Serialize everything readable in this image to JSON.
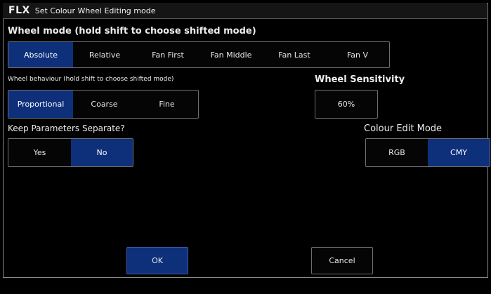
{
  "titlebar": {
    "logo": "FLX",
    "title": "Set Colour Wheel Editing mode"
  },
  "wheel_mode": {
    "heading": "Wheel mode (hold shift to choose shifted mode)",
    "options": [
      "Absolute",
      "Relative",
      "Fan First",
      "Fan Middle",
      "Fan Last",
      "Fan V"
    ],
    "selected": "Absolute"
  },
  "wheel_behaviour": {
    "heading": "Wheel behaviour (hold shift to choose shifted mode)",
    "options": [
      "Proportional",
      "Coarse",
      "Fine"
    ],
    "selected": "Proportional"
  },
  "wheel_sensitivity": {
    "heading": "Wheel Sensitivity",
    "value": "60%"
  },
  "keep_parameters": {
    "heading": "Keep Parameters Separate?",
    "options": [
      "Yes",
      "No"
    ],
    "selected": "No"
  },
  "colour_edit_mode": {
    "heading": "Colour Edit Mode",
    "options": [
      "RGB",
      "CMY"
    ],
    "selected": "CMY"
  },
  "footer": {
    "ok_label": "OK",
    "cancel_label": "Cancel"
  },
  "colors": {
    "selected": "#0e2f7a",
    "background": "#000000",
    "border": "#6f6f6f"
  }
}
